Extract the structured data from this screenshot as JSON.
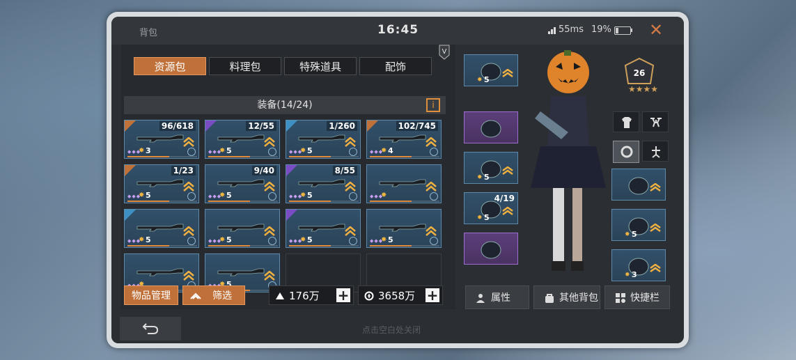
{
  "window": {
    "title": "背包",
    "clock": "16:45",
    "ping": "55ms",
    "battery": "19%"
  },
  "tabs": [
    {
      "label": "资源包",
      "active": true
    },
    {
      "label": "料理包",
      "active": false
    },
    {
      "label": "特殊道具",
      "active": false
    },
    {
      "label": "配饰",
      "active": false
    }
  ],
  "section": {
    "title": "装备(14/24)",
    "info": "i"
  },
  "inventory": [
    {
      "count": "96/618",
      "level": "3",
      "rarity": "orange"
    },
    {
      "count": "12/55",
      "level": "5",
      "rarity": "purple"
    },
    {
      "count": "1/260",
      "level": "5",
      "rarity": "blue"
    },
    {
      "count": "102/745",
      "level": "4",
      "rarity": "orange"
    },
    {
      "count": "1/23",
      "level": "5",
      "rarity": "orange"
    },
    {
      "count": "9/40",
      "level": "5",
      "rarity": "none"
    },
    {
      "count": "8/55",
      "level": "5",
      "rarity": "purple"
    },
    {
      "count": "",
      "level": "",
      "rarity": "none"
    },
    {
      "count": "",
      "level": "5",
      "rarity": "blue"
    },
    {
      "count": "",
      "level": "5",
      "rarity": "none"
    },
    {
      "count": "",
      "level": "5",
      "rarity": "purple"
    },
    {
      "count": "",
      "level": "5",
      "rarity": "none"
    },
    {
      "count": "",
      "level": "",
      "rarity": "none"
    },
    {
      "count": "",
      "level": "5",
      "rarity": "none"
    }
  ],
  "actions": {
    "manage": "物品管理",
    "filter": "筛选"
  },
  "currency": [
    {
      "value": "176万",
      "icon": "mountain-icon"
    },
    {
      "value": "3658万",
      "icon": "coin-icon"
    }
  ],
  "equipment": {
    "left": [
      {
        "count": "",
        "level": "5",
        "type": "blue"
      },
      {
        "count": "",
        "level": "",
        "type": "purple"
      },
      {
        "count": "",
        "level": "5",
        "type": "blue"
      },
      {
        "count": "4/19",
        "level": "5",
        "type": "blue"
      },
      {
        "count": "",
        "level": "",
        "type": "purple"
      }
    ],
    "right": [
      {
        "count": "",
        "level": "",
        "type": "blue"
      },
      {
        "count": "",
        "level": "5",
        "type": "blue"
      },
      {
        "count": "",
        "level": "3",
        "type": "blue"
      }
    ],
    "player_level": "26"
  },
  "bottom_buttons": [
    {
      "label": "属性",
      "icon": "person-icon"
    },
    {
      "label": "其他背包",
      "icon": "bag-icon"
    },
    {
      "label": "快捷栏",
      "icon": "grid-icon"
    }
  ],
  "footer": {
    "hint": "点击空白处关闭"
  }
}
